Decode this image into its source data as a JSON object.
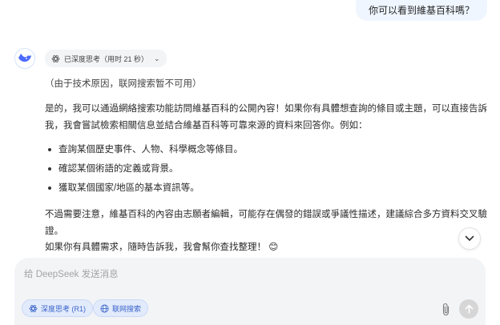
{
  "user_message": "你可以看到維基百科嗎？",
  "assistant": {
    "thinking_label": "已深度思考（用时 21 秒）",
    "note": "（由于技术原因，联网搜索暂不可用）",
    "paragraph1": "是的，我可以通過網絡搜索功能訪問維基百科的公開內容！如果你有具體想查詢的條目或主題，可以直接告訴我，我會嘗試檢索相關信息並結合維基百科等可靠來源的資料來回答你。例如：",
    "bullets": [
      "查詢某個歷史事件、人物、科學概念等條目。",
      "確認某個術語的定義或背景。",
      "獲取某個國家/地區的基本資訊等。"
    ],
    "paragraph2": "不過需要注意，維基百科的內容由志願者編輯，可能存在偶發的錯誤或爭議性描述，建議綜合多方資料交叉驗證。",
    "paragraph3": "如果你有具體需求，隨時告訴我，我會幫你查找整理！",
    "paragraph3_emoji": "😊"
  },
  "composer": {
    "placeholder": "给 DeepSeek 发送消息",
    "deep_think_label": "深度思考 (R1)",
    "web_search_label": "联网搜索"
  },
  "colors": {
    "accent": "#4d6bfe",
    "user_bubble": "#eff6ff",
    "pill_bg": "#e2ebfc"
  },
  "icons": {
    "avatar": "deepseek-whale-icon",
    "thinking": "atom-icon",
    "scroll": "chevron-down-icon",
    "attach": "paperclip-icon",
    "send": "arrow-up-icon"
  }
}
